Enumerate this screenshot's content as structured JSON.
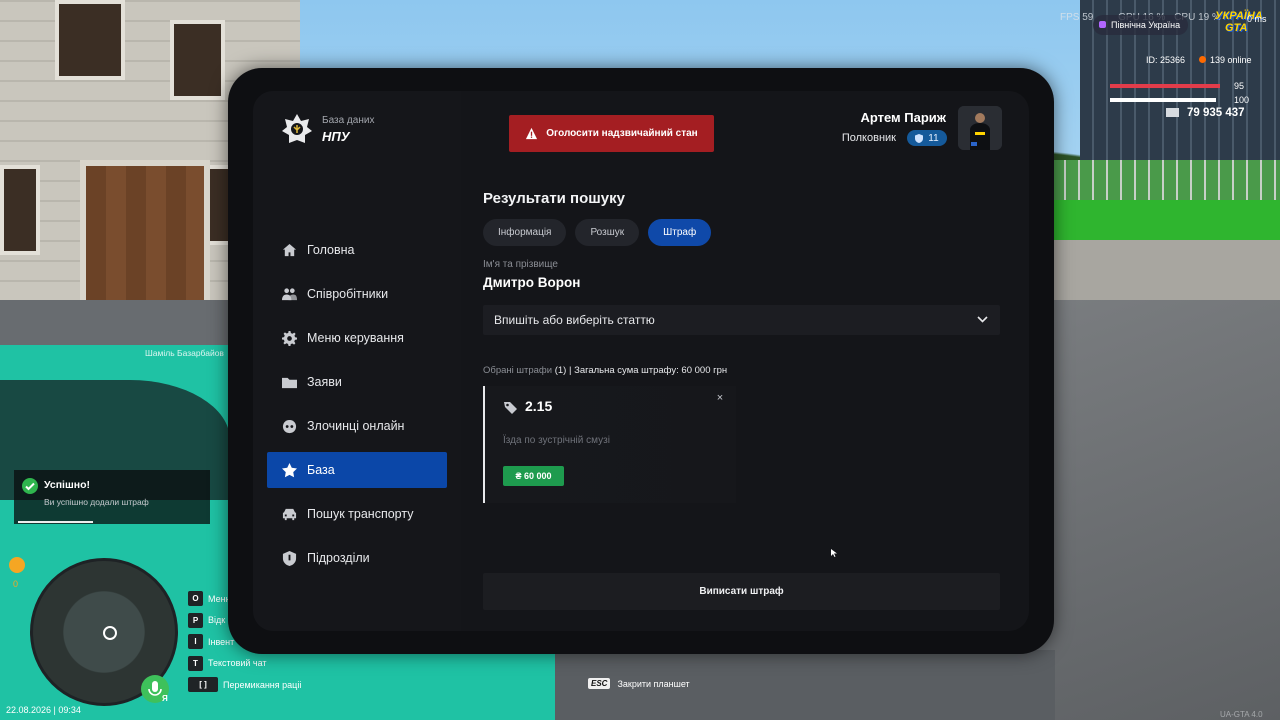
{
  "hud": {
    "fps": "FPS 59",
    "gpu": "GPU 16 %",
    "cpu": "CPU 19 %",
    "ping": "0 ms",
    "region": "Північна Україна",
    "logo_line1": "УКРАЇНА",
    "logo_line2": "GTA",
    "player_id": "ID: 25366",
    "online": "139 online",
    "health": "95",
    "armor": "100",
    "money": "79 935 437",
    "player_label": "Шаміль Базарбайов",
    "hunger": "0",
    "datetime": "22.08.2026 | 09:34",
    "mic_key": "Я",
    "version": "UA-GTA 4.0",
    "esc_key": "ESC",
    "esc_label": "Закрити планшет",
    "keys": [
      {
        "key": "O",
        "label": "Меню"
      },
      {
        "key": "P",
        "label": "Відк"
      },
      {
        "key": "I",
        "label": "Інвент"
      },
      {
        "key": "T",
        "label": "Текстовий чат"
      },
      {
        "key": "[  ]",
        "label": "Перемикання раціі"
      }
    ]
  },
  "toast": {
    "title": "Успішно!",
    "text": "Ви успішно додали штраф",
    "progress": 0.4
  },
  "tablet": {
    "brand": {
      "caption": "База даних",
      "title": "НПУ"
    },
    "emergency_label": "Оголосити надзвичайний стан",
    "user": {
      "name": "Артем Париж",
      "rank": "Полковник",
      "level": "11"
    },
    "nav": [
      {
        "label": "Головна",
        "icon": "home-icon"
      },
      {
        "label": "Співробітники",
        "icon": "people-icon"
      },
      {
        "label": "Меню керування",
        "icon": "gear-icon"
      },
      {
        "label": "Заяви",
        "icon": "folder-icon"
      },
      {
        "label": "Злочинці онлайн",
        "icon": "mask-icon"
      },
      {
        "label": "База",
        "icon": "star-icon",
        "active": true
      },
      {
        "label": "Пошук транспорту",
        "icon": "car-icon"
      },
      {
        "label": "Підрозділи",
        "icon": "shield-icon"
      }
    ],
    "section_title": "Результати пошуку",
    "tabs": [
      {
        "label": "Інформація"
      },
      {
        "label": "Розшук"
      },
      {
        "label": "Штраф",
        "active": true
      }
    ],
    "name_label": "Ім'я та прізвище",
    "person_name": "Дмитро Ворон",
    "article_placeholder": "Впишіть або виберіть статтю",
    "summary_prefix": "Обрані штрафи",
    "summary_count": "(1)",
    "summary_rest": "| Загальна сума штрафу: 60 000 грн",
    "fine": {
      "code": "2.15",
      "description": "Їзда по зустрічній смузі",
      "amount": "₴ 60 000",
      "close": "×"
    },
    "issue_label": "Виписати штраф"
  },
  "colors": {
    "accent": "#0b47a8",
    "danger": "#a41e22",
    "success": "#1e9b4e",
    "panel": "#141519"
  }
}
